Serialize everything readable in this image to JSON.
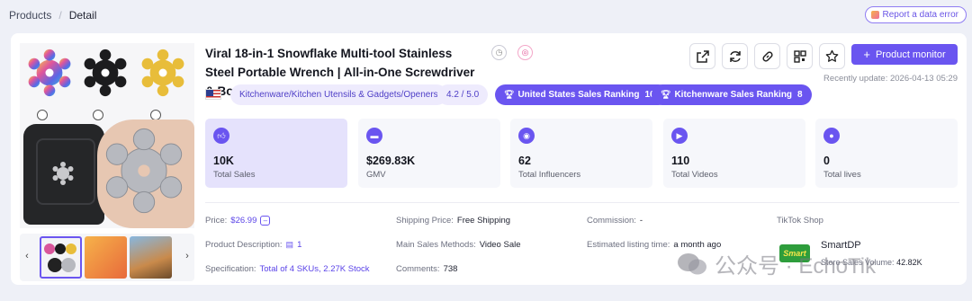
{
  "breadcrumb": {
    "root": "Products",
    "separator": "/",
    "current": "Detail"
  },
  "report_button": "Report a data error",
  "product": {
    "title": "Viral 18-in-1 Snowflake Multi-tool Stainless Steel Portable Wrench | All-in-One Screwdriver & Bottle...",
    "category": "Kitchenware/Kitchen Utensils & Gadgets/Openers",
    "rating": "4.2 / 5.0",
    "rank1_label": "United States Sales Ranking",
    "rank1_value": "167",
    "rank2_label": "Kitchenware Sales Ranking",
    "rank2_value": "8"
  },
  "toolbar": {
    "monitor_label": "Product monitor",
    "recent_update": "Recently update: 2026-04-13 05:29"
  },
  "metrics": [
    {
      "value": "10K",
      "label": "Total Sales",
      "icon": "thumbs-up-icon"
    },
    {
      "value": "$269.83K",
      "label": "GMV",
      "icon": "wallet-icon"
    },
    {
      "value": "62",
      "label": "Total Influencers",
      "icon": "influencer-icon"
    },
    {
      "value": "110",
      "label": "Total Videos",
      "icon": "video-icon"
    },
    {
      "value": "0",
      "label": "Total lives",
      "icon": "live-icon"
    }
  ],
  "info": {
    "price_label": "Price:",
    "price_value": "$26.99",
    "shipping_label": "Shipping Price:",
    "shipping_value": "Free Shipping",
    "commission_label": "Commission:",
    "commission_value": "-",
    "shop_header": "TikTok Shop",
    "desc_label": "Product Description:",
    "desc_value": "1",
    "methods_label": "Main Sales Methods:",
    "methods_value": "Video Sale",
    "listing_label": "Estimated listing time:",
    "listing_value": "a month ago",
    "spec_label": "Specification:",
    "spec_value": "Total of 4 SKUs, 2.27K Stock",
    "comments_label": "Comments:",
    "comments_value": "738"
  },
  "shop": {
    "logo_text": "Smart",
    "name": "SmartDP",
    "volume_label": "Store Sales Volume:",
    "volume_value": "42.82K"
  },
  "watermark": "公众号 · EchoTik",
  "colors": {
    "accent": "#6a55f0",
    "soft": "#eeebfd"
  }
}
